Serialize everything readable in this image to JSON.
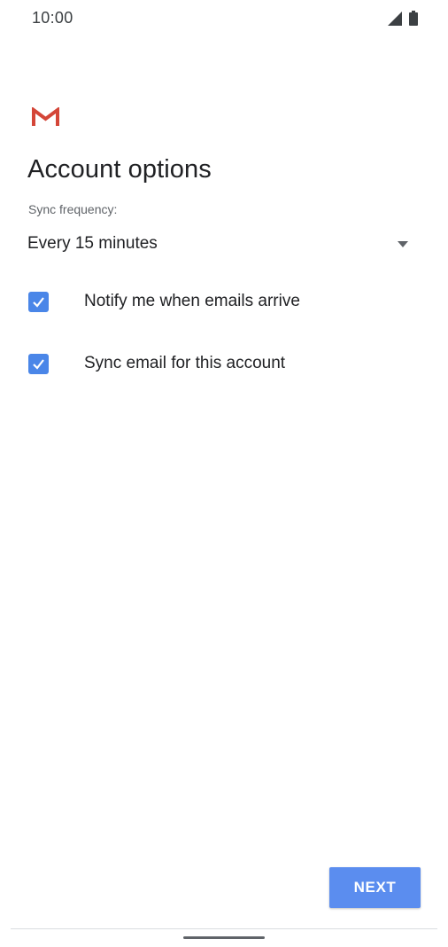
{
  "status_bar": {
    "time": "10:00",
    "icons": [
      "signal-icon",
      "battery-icon"
    ]
  },
  "app": {
    "logo_icon": "gmail-icon"
  },
  "page": {
    "title": "Account options"
  },
  "sync": {
    "label": "Sync frequency:",
    "selected": "Every 15 minutes"
  },
  "options": [
    {
      "label": "Notify me when emails arrive",
      "checked": true
    },
    {
      "label": "Sync email for this account",
      "checked": true
    }
  ],
  "actions": {
    "next_label": "NEXT"
  },
  "colors": {
    "accent": "#4a86e8",
    "button": "#5b8def",
    "gmail_red": "#d44638"
  }
}
